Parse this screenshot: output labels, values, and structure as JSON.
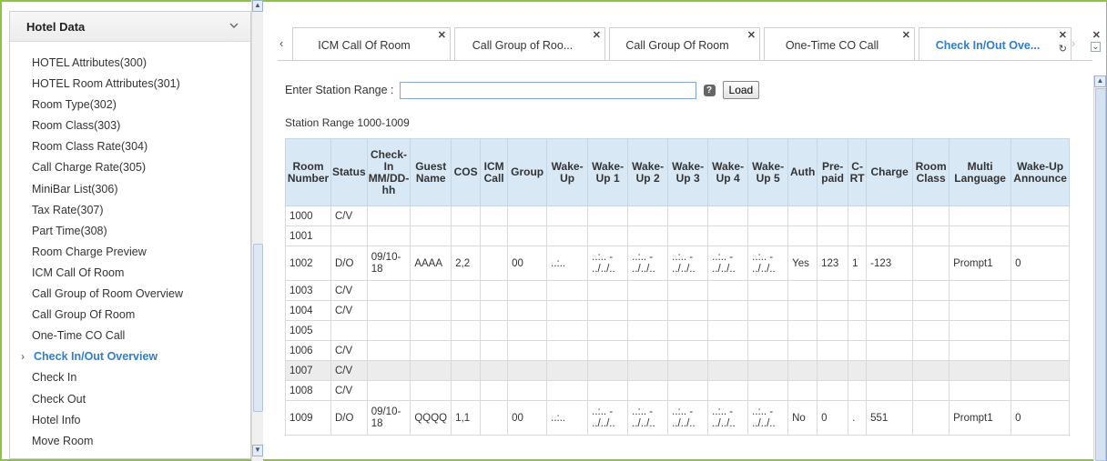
{
  "sidebar": {
    "title": "Hotel Data",
    "items": [
      "HOTEL Attributes(300)",
      "HOTEL Room Attributes(301)",
      "Room Type(302)",
      "Room Class(303)",
      "Room Class Rate(304)",
      "Call Charge Rate(305)",
      "MiniBar List(306)",
      "Tax Rate(307)",
      "Part Time(308)",
      "Room Charge Preview",
      "ICM Call Of Room",
      "Call Group of Room Overview",
      "Call Group Of Room",
      "One-Time CO Call",
      "Check In/Out Overview",
      "Check In",
      "Check Out",
      "Hotel Info",
      "Move Room"
    ],
    "active_index": 14
  },
  "tabs": [
    {
      "label": "ICM Call Of Room",
      "active": false
    },
    {
      "label": "Call Group of Roo...",
      "active": false
    },
    {
      "label": "Call Group Of Room",
      "active": false
    },
    {
      "label": "One-Time CO Call",
      "active": false
    },
    {
      "label": "Check In/Out Ove...",
      "active": true
    }
  ],
  "range": {
    "label": "Enter Station Range :",
    "value": "",
    "load_label": "Load",
    "caption": "Station Range 1000-1009"
  },
  "table": {
    "headers": [
      "Room Number",
      "Status",
      "Check-In MM/DD-hh",
      "Guest Name",
      "COS",
      "ICM Call",
      "Group",
      "Wake-Up",
      "Wake-Up 1",
      "Wake-Up 2",
      "Wake-Up 3",
      "Wake-Up 4",
      "Wake-Up 5",
      "Auth",
      "Pre-paid",
      "C-RT",
      "Charge",
      "Room Class",
      "Multi Language",
      "Wake-Up Announce"
    ],
    "rows": [
      [
        "1000",
        "C/V",
        "",
        "",
        "",
        "",
        "",
        "",
        "",
        "",
        "",
        "",
        "",
        "",
        "",
        "",
        "",
        "",
        "",
        ""
      ],
      [
        "1001",
        "",
        "",
        "",
        "",
        "",
        "",
        "",
        "",
        "",
        "",
        "",
        "",
        "",
        "",
        "",
        "",
        "",
        "",
        ""
      ],
      [
        "1002",
        "D/O",
        "09/10-18",
        "AAAA",
        "2,2",
        "",
        "00",
        "..:..",
        "..:.. - ../../..",
        "..:.. - ../../..",
        "..:.. - ../../..",
        "..:.. - ../../..",
        "..:.. - ../../..",
        "Yes",
        "123",
        "1",
        "-123",
        "",
        "Prompt1",
        "0"
      ],
      [
        "1003",
        "C/V",
        "",
        "",
        "",
        "",
        "",
        "",
        "",
        "",
        "",
        "",
        "",
        "",
        "",
        "",
        "",
        "",
        "",
        ""
      ],
      [
        "1004",
        "C/V",
        "",
        "",
        "",
        "",
        "",
        "",
        "",
        "",
        "",
        "",
        "",
        "",
        "",
        "",
        "",
        "",
        "",
        ""
      ],
      [
        "1005",
        "",
        "",
        "",
        "",
        "",
        "",
        "",
        "",
        "",
        "",
        "",
        "",
        "",
        "",
        "",
        "",
        "",
        "",
        ""
      ],
      [
        "1006",
        "C/V",
        "",
        "",
        "",
        "",
        "",
        "",
        "",
        "",
        "",
        "",
        "",
        "",
        "",
        "",
        "",
        "",
        "",
        ""
      ],
      [
        "1007",
        "C/V",
        "",
        "",
        "",
        "",
        "",
        "",
        "",
        "",
        "",
        "",
        "",
        "",
        "",
        "",
        "",
        "",
        "",
        ""
      ],
      [
        "1008",
        "C/V",
        "",
        "",
        "",
        "",
        "",
        "",
        "",
        "",
        "",
        "",
        "",
        "",
        "",
        "",
        "",
        "",
        "",
        ""
      ],
      [
        "1009",
        "D/O",
        "09/10-18",
        "QQQQ",
        "1,1",
        "",
        "00",
        "..:..",
        "..:.. - ../../..",
        "..:.. - ../../..",
        "..:.. - ../../..",
        "..:.. - ../../..",
        "..:.. - ../../..",
        "No",
        "0",
        ".",
        "551",
        "",
        "Prompt1",
        "0"
      ]
    ],
    "highlight_row": 7
  }
}
